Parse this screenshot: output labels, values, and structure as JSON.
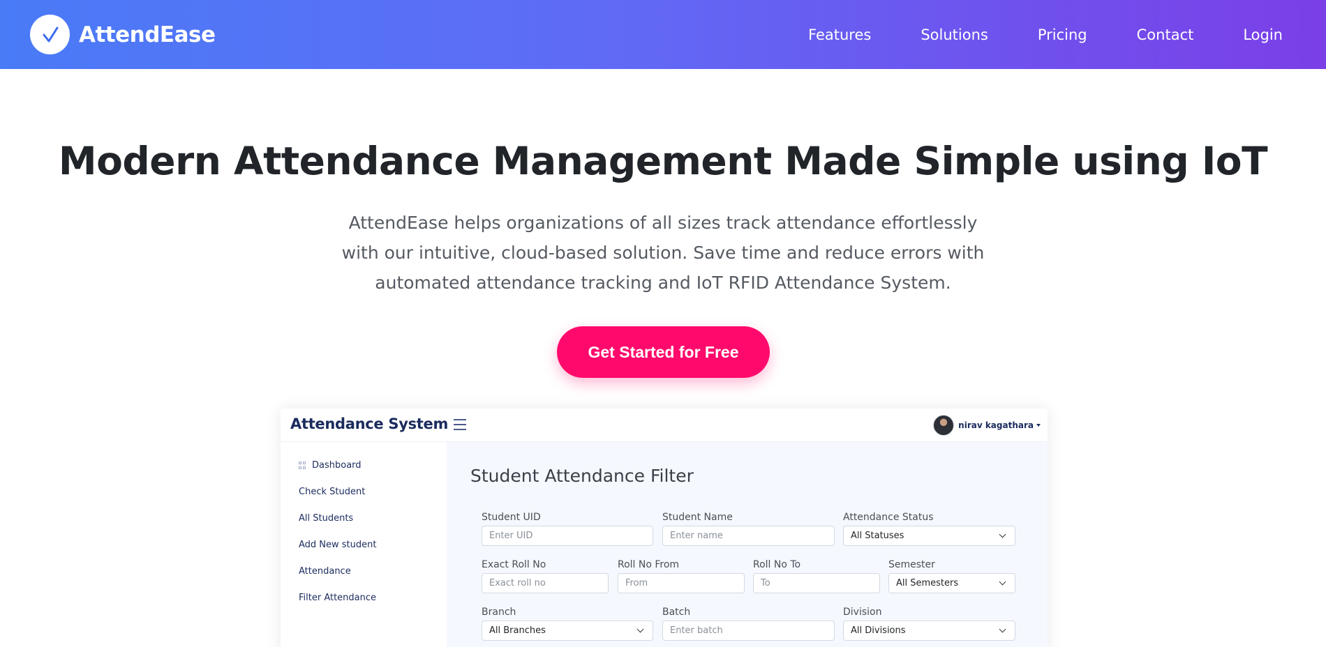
{
  "navbar": {
    "brand": "AttendEase",
    "links": [
      "Features",
      "Solutions",
      "Pricing",
      "Contact",
      "Login"
    ]
  },
  "hero": {
    "title": "Modern Attendance Management Made Simple using IoT",
    "subtitle": "AttendEase helps organizations of all sizes track attendance effortlessly with our intuitive, cloud-based solution. Save time and reduce errors with automated attendance tracking and IoT RFID Attendance System.",
    "cta": "Get Started for Free"
  },
  "preview": {
    "app_title": "Attendance System",
    "user_name": "nirav kagathara",
    "sidebar": [
      "Dashboard",
      "Check Student",
      "All Students",
      "Add New student",
      "Attendance",
      "Filter Attendance"
    ],
    "filter_title": "Student Attendance Filter",
    "fields": {
      "uid_label": "Student UID",
      "uid_placeholder": "Enter UID",
      "name_label": "Student Name",
      "name_placeholder": "Enter name",
      "status_label": "Attendance Status",
      "status_value": "All Statuses",
      "exact_roll_label": "Exact Roll No",
      "exact_roll_placeholder": "Exact roll no",
      "roll_from_label": "Roll No From",
      "roll_from_placeholder": "From",
      "roll_to_label": "Roll No To",
      "roll_to_placeholder": "To",
      "semester_label": "Semester",
      "semester_value": "All Semesters",
      "branch_label": "Branch",
      "branch_value": "All Branches",
      "batch_label": "Batch",
      "batch_placeholder": "Enter batch",
      "division_label": "Division",
      "division_value": "All Divisions"
    }
  },
  "colors": {
    "nav_gradient_start": "#4a7bf7",
    "nav_gradient_end": "#7b3fe8",
    "cta": "#ff0a6c",
    "app_text": "#1b2b5e"
  }
}
